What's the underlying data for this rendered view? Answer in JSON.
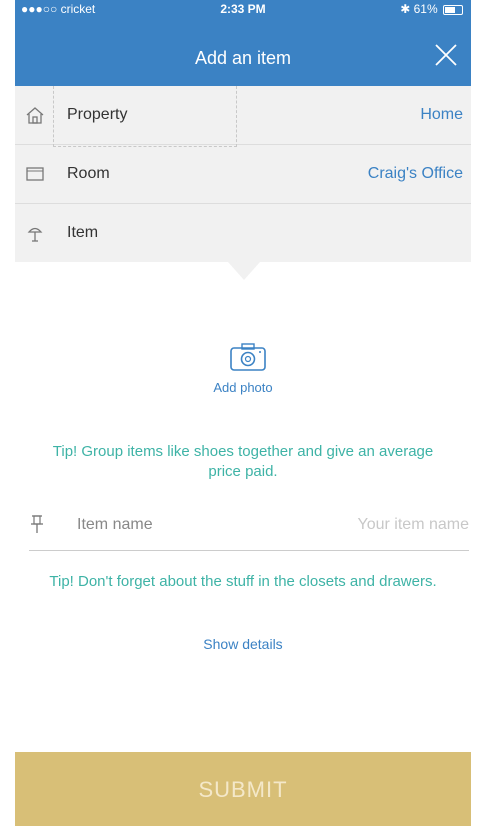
{
  "status_bar": {
    "carrier": "●●●○○ cricket",
    "time": "2:33 PM",
    "battery": "61%"
  },
  "header": {
    "title": "Add an item"
  },
  "property": {
    "label": "Property",
    "value": "Home"
  },
  "room": {
    "label": "Room",
    "value": "Craig's Office"
  },
  "item": {
    "label": "Item"
  },
  "photo": {
    "label": "Add photo"
  },
  "tips": {
    "group": "Tip! Group items like shoes together and give an average price paid.",
    "closets": "Tip! Don't forget about the stuff in the closets and drawers."
  },
  "item_name": {
    "label": "Item name",
    "placeholder": "Your item name"
  },
  "details": {
    "label": "Show details"
  },
  "submit": {
    "label": "SUBMIT"
  },
  "colors": {
    "brand_blue": "#3b82c4",
    "tip_teal": "#3eb3a6",
    "submit_gold": "#d8bf77"
  }
}
